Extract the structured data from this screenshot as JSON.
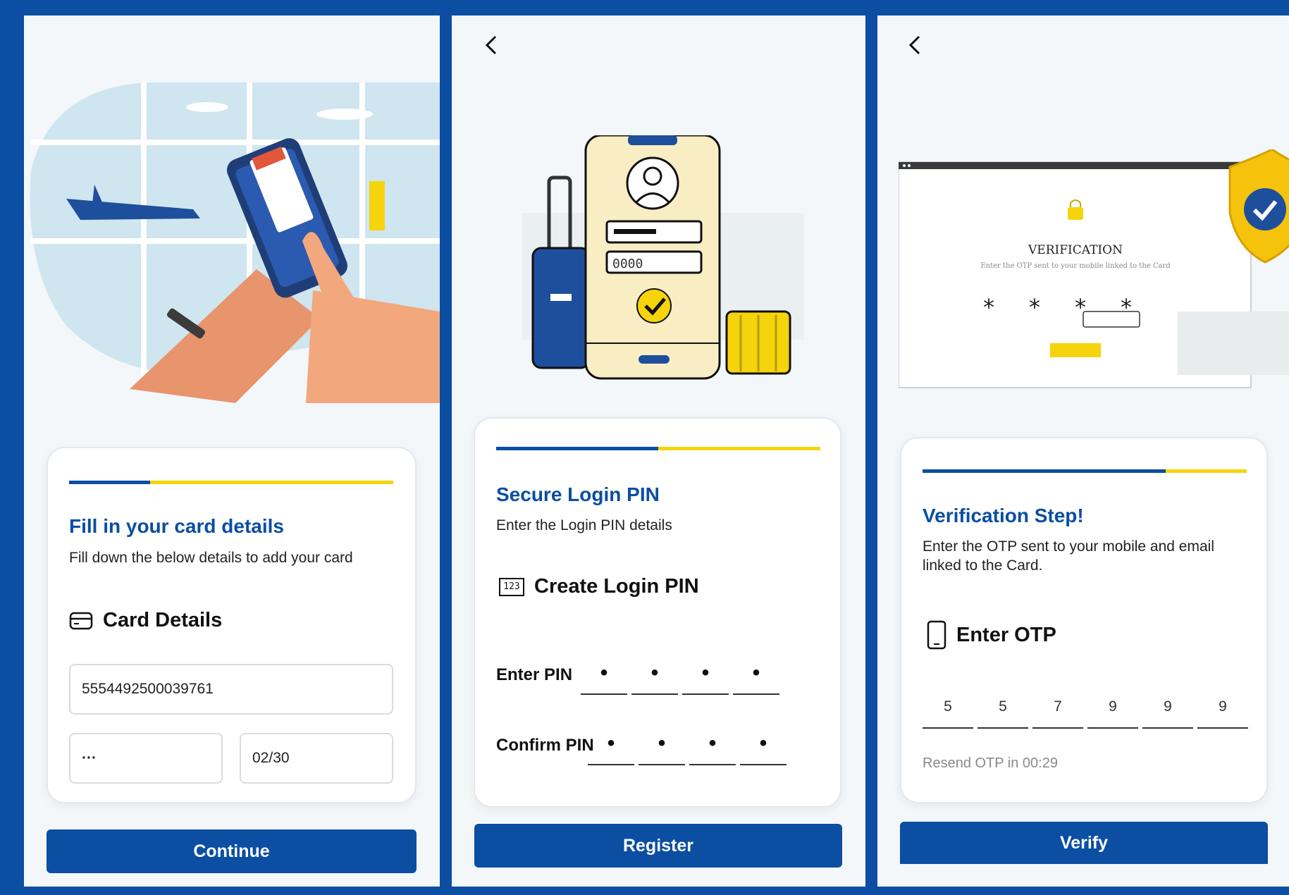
{
  "screen1": {
    "title": "Fill in your card details",
    "subtitle": "Fill down the below details to add your card",
    "section_label": "Card Details",
    "section_icon": "credit-card-icon",
    "card_number": "5554492500039761",
    "cvv": "···",
    "expiry": "02/30",
    "progress_fraction": 0.25,
    "button_label": "Continue"
  },
  "screen2": {
    "title": "Secure Login PIN",
    "subtitle": "Enter the Login PIN details",
    "section_label": "Create Login PIN",
    "section_icon": "keypad-123-icon",
    "section_icon_text": "123",
    "enter_pin_label": "Enter PIN",
    "confirm_pin_label": "Confirm PIN",
    "pin_mask": "•",
    "progress_fraction": 0.5,
    "button_label": "Register",
    "illustration": {
      "pin_placeholder": "0000"
    }
  },
  "screen3": {
    "title": "Verification Step!",
    "subtitle_line1": "Enter the OTP sent to your mobile and email",
    "subtitle_line2": "linked to the Card.",
    "section_label": "Enter OTP",
    "section_icon": "mobile-phone-icon",
    "otp_digits": [
      "5",
      "5",
      "7",
      "9",
      "9",
      "9"
    ],
    "resend_text": "Resend OTP in 00:29",
    "progress_fraction": 0.75,
    "button_label": "Verify",
    "illustration": {
      "heading": "VERIFICATION",
      "caption": "Enter the OTP sent to your mobile linked to the Card",
      "mask": "*"
    }
  },
  "colors": {
    "brand_blue": "#0b4ea2",
    "accent_yellow": "#f5d40c",
    "background": "#f3f7fa"
  }
}
